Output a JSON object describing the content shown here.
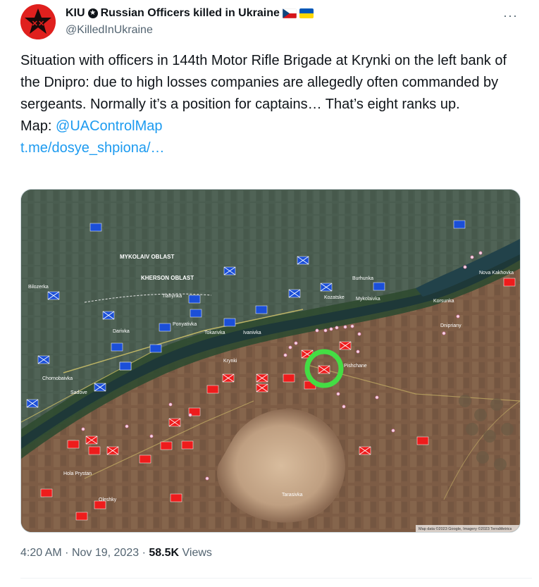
{
  "tweet": {
    "display_name": "KIU",
    "name_suffix": "Russian Officers killed in Ukraine",
    "handle": "@KilledInUkraine",
    "more_icon": "more-dots-icon",
    "body": "Situation with officers in 144th Motor Rifle Brigade at Krynki on the left bank of the Dnipro: due to high losses companies are allegedly often commanded by sergeants. Normally it’s a position for captains… That’s eight ranks up.",
    "map_label": "Map:",
    "map_link": "@UAControlMap",
    "tg_link": "t.me/dosye_shpiona/…",
    "time": "4:20 AM",
    "date": "Nov 19, 2023",
    "views_count": "58.5K",
    "views_label": "Views"
  },
  "map": {
    "labels": {
      "mykolaiv_oblast": "MYKOLAIV OBLAST",
      "kherson_oblast": "KHERSON OBLAST",
      "krynki": "Krynki",
      "pishchane": "Pishchane",
      "korsunka": "Korsunka",
      "dnipriany": "Dnipriany",
      "nova_kakhovka": "Nova Kakhovka",
      "hola_prystan": "Hola Prystan",
      "oleshky": "Oleshky",
      "tarasivka": "Tarasivka",
      "tokarivka": "Tokarivka",
      "ponyativka": "Ponyativka",
      "darivka": "Darivka",
      "mykolaivka": "Mykolaivka",
      "ivanivka": "Ivanivka",
      "sadove": "Sadove",
      "chornobaivka": "Chornobaivka",
      "bilozerka": "Bilozerka",
      "kozatske": "Kozatske",
      "burhunka": "Burhunka",
      "tiahynka": "Tiahynka",
      "attribution": "Map data ©2023 Google, Imagery ©2023 TerraMetrics"
    },
    "colors": {
      "russian": "#ee1c1c",
      "ukrainian": "#1b4fd8",
      "highlight": "#44dd44",
      "river": "#1f3a3a",
      "right_bank": "#4c6053",
      "left_bank": "#7a5b45",
      "sand": "#c8a98c"
    }
  }
}
